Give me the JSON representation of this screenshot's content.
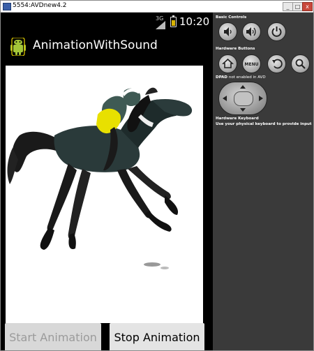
{
  "window": {
    "title": "5554:AVDnew4.2",
    "buttons": {
      "minimize": "_",
      "maximize": "□",
      "close": "x"
    }
  },
  "status_bar": {
    "network": "3G",
    "time": "10:20",
    "battery_fill": 0.6
  },
  "app": {
    "title": "AnimationWithSound"
  },
  "content": {
    "image": "horse-and-jockey-image"
  },
  "buttons": {
    "start": "Start Animation",
    "stop": "Stop Animation"
  },
  "controls": {
    "basic_title": "Basic Controls",
    "hardware_title": "Hardware Buttons",
    "menu_label": "MENU",
    "dpad_title": "DPAD",
    "dpad_note": "not enabled in AVD",
    "keyboard_title": "Hardware Keyboard",
    "keyboard_note": "Use your physical keyboard to provide input"
  },
  "icons": [
    "volume-down-icon",
    "volume-up-icon",
    "power-icon",
    "home-icon",
    "menu-icon",
    "back-icon",
    "search-icon",
    "android-icon"
  ]
}
